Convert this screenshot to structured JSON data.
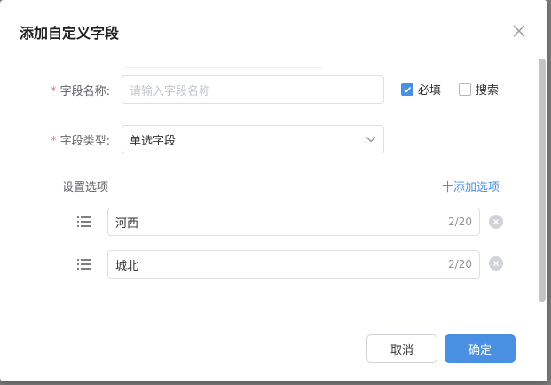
{
  "dialog": {
    "title": "添加自定义字段",
    "close_icon": "close-icon"
  },
  "form": {
    "field_name": {
      "required_mark": "*",
      "label": "字段名称:",
      "value": "",
      "placeholder": "请输入字段名称"
    },
    "required_checkbox": {
      "label": "必填",
      "checked": true
    },
    "search_checkbox": {
      "label": "搜索",
      "checked": false
    },
    "field_type": {
      "required_mark": "*",
      "label": "字段类型:",
      "value": "单选字段",
      "icon": "chevron-down-icon"
    },
    "options_section": {
      "label": "设置选项",
      "add_label": "十添加选项"
    },
    "options": [
      {
        "value": "河西",
        "count": "2/20"
      },
      {
        "value": "城北",
        "count": "2/20"
      }
    ]
  },
  "footer": {
    "cancel_label": "取消",
    "confirm_label": "确定"
  },
  "colors": {
    "accent": "#4a90e2",
    "required": "#f56c6c"
  }
}
